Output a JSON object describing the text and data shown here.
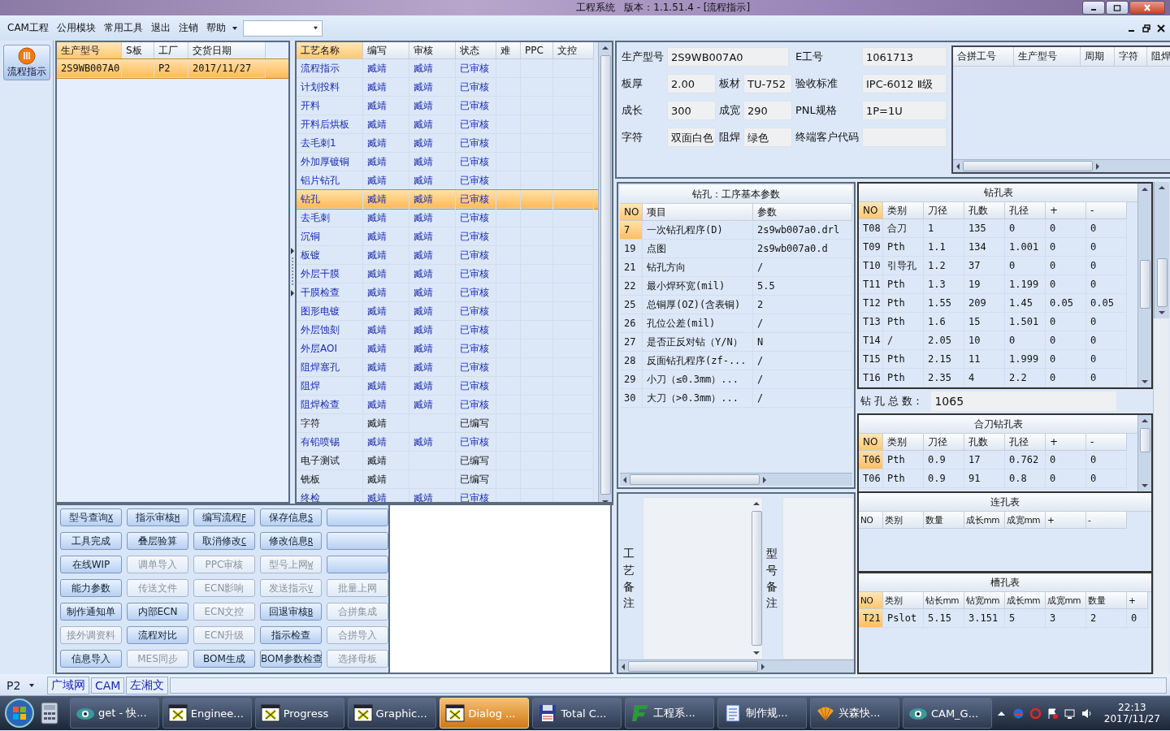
{
  "window": {
    "title": "工程系统   版本：1.1.51.4 - [流程指示]"
  },
  "menu": [
    "CAM工程",
    "公用模块",
    "常用工具",
    "退出",
    "注销",
    "帮助"
  ],
  "sidebar": {
    "items": [
      {
        "label": "流程指示",
        "selected": true
      }
    ]
  },
  "product_list": {
    "columns": [
      "生产型号",
      "S板",
      "工厂",
      "交货日期"
    ],
    "rows": [
      {
        "model": "2S9WB007A0",
        "factory": "P2",
        "delivery": "2017/11/27",
        "selected": true
      }
    ]
  },
  "process_table": {
    "columns": [
      "工艺名称",
      "编写",
      "审核",
      "状态",
      "难",
      "PPC",
      "文控"
    ],
    "rows": [
      {
        "name": "流程指示",
        "writer": "臧靖",
        "reviewer": "臧靖",
        "status": "已审核",
        "approved": true,
        "selected": false
      },
      {
        "name": "计划投料",
        "writer": "臧靖",
        "reviewer": "臧靖",
        "status": "已审核",
        "approved": true,
        "selected": false
      },
      {
        "name": "开料",
        "writer": "臧靖",
        "reviewer": "臧靖",
        "status": "已审核",
        "approved": true,
        "selected": false
      },
      {
        "name": "开料后烘板",
        "writer": "臧靖",
        "reviewer": "臧靖",
        "status": "已审核",
        "approved": true,
        "selected": false
      },
      {
        "name": "去毛刺1",
        "writer": "臧靖",
        "reviewer": "臧靖",
        "status": "已审核",
        "approved": true,
        "selected": false
      },
      {
        "name": "外加厚镀铜",
        "writer": "臧靖",
        "reviewer": "臧靖",
        "status": "已审核",
        "approved": true,
        "selected": false
      },
      {
        "name": "铝片钻孔",
        "writer": "臧靖",
        "reviewer": "臧靖",
        "status": "已审核",
        "approved": true,
        "selected": false
      },
      {
        "name": "钻孔",
        "writer": "臧靖",
        "reviewer": "臧靖",
        "status": "已审核",
        "approved": true,
        "selected": true
      },
      {
        "name": "去毛刺",
        "writer": "臧靖",
        "reviewer": "臧靖",
        "status": "已审核",
        "approved": true,
        "selected": false
      },
      {
        "name": "沉铜",
        "writer": "臧靖",
        "reviewer": "臧靖",
        "status": "已审核",
        "approved": true,
        "selected": false
      },
      {
        "name": "板镀",
        "writer": "臧靖",
        "reviewer": "臧靖",
        "status": "已审核",
        "approved": true,
        "selected": false
      },
      {
        "name": "外层干膜",
        "writer": "臧靖",
        "reviewer": "臧靖",
        "status": "已审核",
        "approved": true,
        "selected": false
      },
      {
        "name": "干膜检查",
        "writer": "臧靖",
        "reviewer": "臧靖",
        "status": "已审核",
        "approved": true,
        "selected": false
      },
      {
        "name": "图形电镀",
        "writer": "臧靖",
        "reviewer": "臧靖",
        "status": "已审核",
        "approved": true,
        "selected": false
      },
      {
        "name": "外层蚀刻",
        "writer": "臧靖",
        "reviewer": "臧靖",
        "status": "已审核",
        "approved": true,
        "selected": false
      },
      {
        "name": "外层AOI",
        "writer": "臧靖",
        "reviewer": "臧靖",
        "status": "已审核",
        "approved": true,
        "selected": false
      },
      {
        "name": "阻焊塞孔",
        "writer": "臧靖",
        "reviewer": "臧靖",
        "status": "已审核",
        "approved": true,
        "selected": false
      },
      {
        "name": "阻焊",
        "writer": "臧靖",
        "reviewer": "臧靖",
        "status": "已审核",
        "approved": true,
        "selected": false
      },
      {
        "name": "阻焊检查",
        "writer": "臧靖",
        "reviewer": "臧靖",
        "status": "已审核",
        "approved": true,
        "selected": false
      },
      {
        "name": "字符",
        "writer": "臧靖",
        "status": "已编写",
        "approved": false,
        "selected": false
      },
      {
        "name": "有铅喷锡",
        "writer": "臧靖",
        "reviewer": "臧靖",
        "status": "已审核",
        "approved": true,
        "selected": false
      },
      {
        "name": "电子测试",
        "writer": "臧靖",
        "status": "已编写",
        "approved": false,
        "selected": false
      },
      {
        "name": "铣板",
        "writer": "臧靖",
        "status": "已编写",
        "approved": false,
        "selected": false
      },
      {
        "name": "终检",
        "writer": "臧靖",
        "reviewer": "臧靖",
        "status": "已审核",
        "approved": true,
        "selected": false
      }
    ]
  },
  "buttons": [
    {
      "label": "型号查询",
      "key": "X",
      "disabled": false
    },
    {
      "label": "指示审核",
      "key": "H",
      "disabled": false
    },
    {
      "label": "编写流程",
      "key": "F",
      "disabled": false
    },
    {
      "label": "保存信息",
      "key": "S",
      "disabled": false
    },
    {
      "disabled": false
    },
    {
      "label": "工具完成",
      "disabled": false
    },
    {
      "label": "叠层验算",
      "disabled": false
    },
    {
      "label": "取消修改",
      "key": "C",
      "disabled": false
    },
    {
      "label": "修改信息",
      "key": "R",
      "disabled": false
    },
    {
      "disabled": false
    },
    {
      "label": "在线WIP",
      "disabled": false
    },
    {
      "label": "调单导入",
      "disabled": true
    },
    {
      "label": "PPC审核",
      "disabled": true
    },
    {
      "label": "型号上网",
      "key": "W",
      "disabled": true
    },
    {
      "disabled": false
    },
    {
      "label": "能力参数",
      "disabled": false
    },
    {
      "label": "传送文件",
      "disabled": true
    },
    {
      "label": "ECN影响",
      "disabled": true
    },
    {
      "label": "发送指示",
      "key": "V",
      "disabled": true
    },
    {
      "label": "批量上网",
      "disabled": true
    },
    {
      "label": "制作通知单",
      "disabled": false
    },
    {
      "label": "内部ECN",
      "disabled": false
    },
    {
      "label": "ECN文控",
      "disabled": true
    },
    {
      "label": "回退审核",
      "key": "B",
      "disabled": false
    },
    {
      "label": "合拼集成",
      "disabled": true
    },
    {
      "label": "接外调资料",
      "disabled": true
    },
    {
      "label": "流程对比",
      "disabled": false
    },
    {
      "label": "ECN升级",
      "disabled": true
    },
    {
      "label": "指示检查",
      "disabled": false
    },
    {
      "label": "合拼导入",
      "disabled": true
    },
    {
      "label": "信息导入",
      "disabled": false
    },
    {
      "label": "MES同步",
      "disabled": true
    },
    {
      "label": "BOM生成",
      "disabled": false
    },
    {
      "label": "BOM参数检查",
      "disabled": false
    },
    {
      "label": "选择母板",
      "disabled": true
    }
  ],
  "info": {
    "rows": [
      [
        {
          "label": "生产型号",
          "value": "2S9WB007A0"
        },
        {},
        {
          "label": "E工号",
          "value": "1061713"
        }
      ],
      [
        {
          "label": "板厚",
          "value": "2.00"
        },
        {
          "label": "板材",
          "value": "TU-752"
        },
        {
          "label": "验收标准",
          "value": "IPC-6012 Ⅱ级"
        }
      ],
      [
        {
          "label": "成长",
          "value": "300"
        },
        {
          "label": "成宽",
          "value": "290"
        },
        {
          "label": "PNL规格",
          "value": "1P=1U"
        }
      ],
      [
        {
          "label": "字符",
          "value": "双面白色"
        },
        {
          "label": "阻焊",
          "value": "绿色"
        },
        {
          "label": "终端客户代码"
        }
      ]
    ]
  },
  "merge_table": {
    "columns": [
      "合拼工号",
      "生产型号",
      "周期",
      "字符",
      "阻焊"
    ]
  },
  "drill_params": {
    "title": "钻孔：工序基本参数",
    "columns": [
      "NO",
      "项目",
      "参数"
    ],
    "rows": [
      {
        "no": "7",
        "item": "一次钻孔程序(D)",
        "param": "2s9wb007a0.drl",
        "selected": true
      },
      {
        "no": "19",
        "item": "点图",
        "param": "2s9wb007a0.d",
        "selected": false
      },
      {
        "no": "21",
        "item": "钻孔方向",
        "param": "/",
        "selected": false
      },
      {
        "no": "22",
        "item": "最小焊环宽(mil)",
        "param": "5.5",
        "selected": false
      },
      {
        "no": "25",
        "item": "总铜厚(OZ)(含表铜)",
        "param": "2",
        "selected": false
      },
      {
        "no": "26",
        "item": "孔位公差(mil)",
        "param": "/",
        "selected": false
      },
      {
        "no": "27",
        "item": "是否正反对钻（Y/N）",
        "param": "N",
        "selected": false
      },
      {
        "no": "28",
        "item": "反面钻孔程序(zf-...",
        "param": "/",
        "selected": false
      },
      {
        "no": "29",
        "item": "小刀（≤0.3mm）...",
        "param": "/",
        "selected": false
      },
      {
        "no": "30",
        "item": "大刀（>0.3mm）...",
        "param": "/",
        "selected": false
      }
    ]
  },
  "notes": {
    "process_label": "工艺备注",
    "model_label": "型号备注"
  },
  "drill_table": {
    "title": "钻孔表",
    "columns": [
      "NO",
      "类别",
      "刀径",
      "孔数",
      "孔径",
      "+",
      "-"
    ],
    "rows": [
      {
        "cells": [
          "T08",
          "合刀",
          "1",
          "135",
          "0",
          "0",
          "0"
        ],
        "selected": false
      },
      {
        "cells": [
          "T09",
          "Pth",
          "1.1",
          "134",
          "1.001",
          "0",
          "0"
        ],
        "selected": false
      },
      {
        "cells": [
          "T10",
          "引导孔",
          "1.2",
          "37",
          "0",
          "0",
          "0"
        ],
        "selected": false
      },
      {
        "cells": [
          "T11",
          "Pth",
          "1.3",
          "19",
          "1.199",
          "0",
          "0"
        ],
        "selected": false
      },
      {
        "cells": [
          "T12",
          "Pth",
          "1.55",
          "209",
          "1.45",
          "0.05",
          "0.05"
        ],
        "selected": false
      },
      {
        "cells": [
          "T13",
          "Pth",
          "1.6",
          "15",
          "1.501",
          "0",
          "0"
        ],
        "selected": false
      },
      {
        "cells": [
          "T14",
          "/",
          "2.05",
          "10",
          "0",
          "0",
          "0"
        ],
        "selected": false
      },
      {
        "cells": [
          "T15",
          "Pth",
          "2.15",
          "11",
          "1.999",
          "0",
          "0"
        ],
        "selected": false
      },
      {
        "cells": [
          "T16",
          "Pth",
          "2.35",
          "4",
          "2.2",
          "0",
          "0"
        ],
        "selected": false
      }
    ]
  },
  "drill_total": {
    "label": "钻 孔 总 数：",
    "value": "1065"
  },
  "merge_drill_table": {
    "title": "合刀钻孔表",
    "columns": [
      "NO",
      "类别",
      "刀径",
      "孔数",
      "孔径",
      "+",
      "-"
    ],
    "rows": [
      {
        "cells": [
          "T06",
          "Pth",
          "0.9",
          "17",
          "0.762",
          "0",
          "0"
        ],
        "selected": true
      },
      {
        "cells": [
          "T06",
          "Pth",
          "0.9",
          "91",
          "0.8",
          "0",
          "0"
        ],
        "selected": false
      }
    ]
  },
  "connect_table": {
    "title": "连孔表",
    "columns": [
      "NO",
      "类别",
      "数量",
      "成长mm",
      "成宽mm",
      "+",
      "-"
    ]
  },
  "slot_table": {
    "title": "槽孔表",
    "columns": [
      "NO",
      "类别",
      "钻长mm",
      "钻宽mm",
      "成长mm",
      "成宽mm",
      "数量",
      "+"
    ],
    "rows": [
      {
        "cells": [
          "T21",
          "Pslot",
          "5.15",
          "3.151",
          "5",
          "3",
          "2",
          "0"
        ],
        "selected": true
      }
    ]
  },
  "status_bar": {
    "factory": "P2",
    "items": [
      "广域网",
      "CAM",
      "左湘文"
    ]
  },
  "taskbar": {
    "tasks": [
      {
        "label": "get - 快...",
        "kind": "eye",
        "active": false
      },
      {
        "label": "Enginee...",
        "kind": "window",
        "active": false
      },
      {
        "label": "Progress",
        "kind": "window",
        "active": false
      },
      {
        "label": "Graphic...",
        "kind": "window",
        "active": false
      },
      {
        "label": "Dialog ...",
        "kind": "window",
        "active": true
      },
      {
        "label": "Total C...",
        "kind": "floppy",
        "active": false
      },
      {
        "label": "工程系...",
        "kind": "green",
        "active": false
      },
      {
        "label": "制作规...",
        "kind": "notepad",
        "active": false
      },
      {
        "label": "兴森快...",
        "kind": "shell",
        "active": false
      },
      {
        "label": "CAM_G...",
        "kind": "eye",
        "active": false
      }
    ],
    "time": "22:13",
    "date": "2017/11/27"
  }
}
